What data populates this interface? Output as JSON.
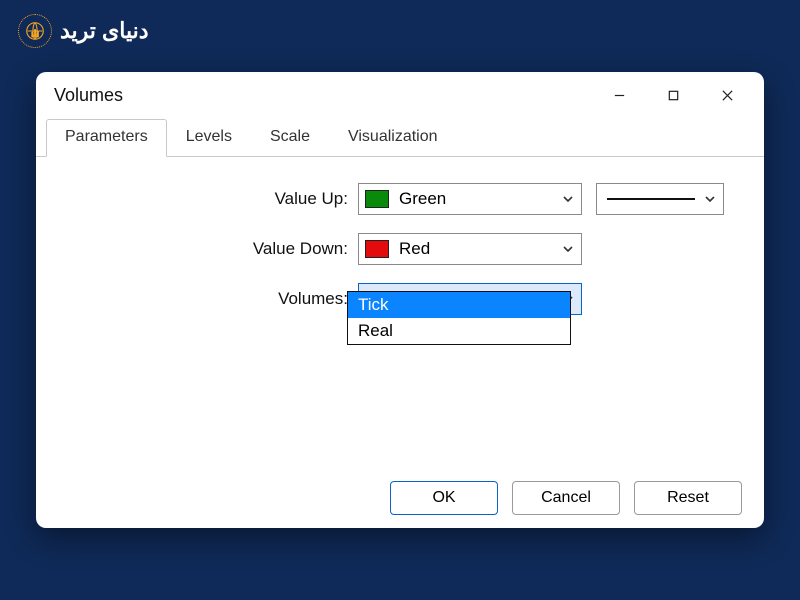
{
  "logo": {
    "text": "دنیای ترید"
  },
  "window": {
    "title": "Volumes"
  },
  "tabs": {
    "items": [
      {
        "label": "Parameters",
        "active": true
      },
      {
        "label": "Levels",
        "active": false
      },
      {
        "label": "Scale",
        "active": false
      },
      {
        "label": "Visualization",
        "active": false
      }
    ]
  },
  "fields": {
    "value_up": {
      "label": "Value Up:",
      "color_name": "Green",
      "swatch": "#0a8a0a"
    },
    "value_down": {
      "label": "Value Down:",
      "color_name": "Red",
      "swatch": "#e30b0b"
    },
    "volumes": {
      "label": "Volumes:",
      "selected": "Tick",
      "options": [
        "Tick",
        "Real"
      ]
    }
  },
  "buttons": {
    "ok": "OK",
    "cancel": "Cancel",
    "reset": "Reset"
  }
}
